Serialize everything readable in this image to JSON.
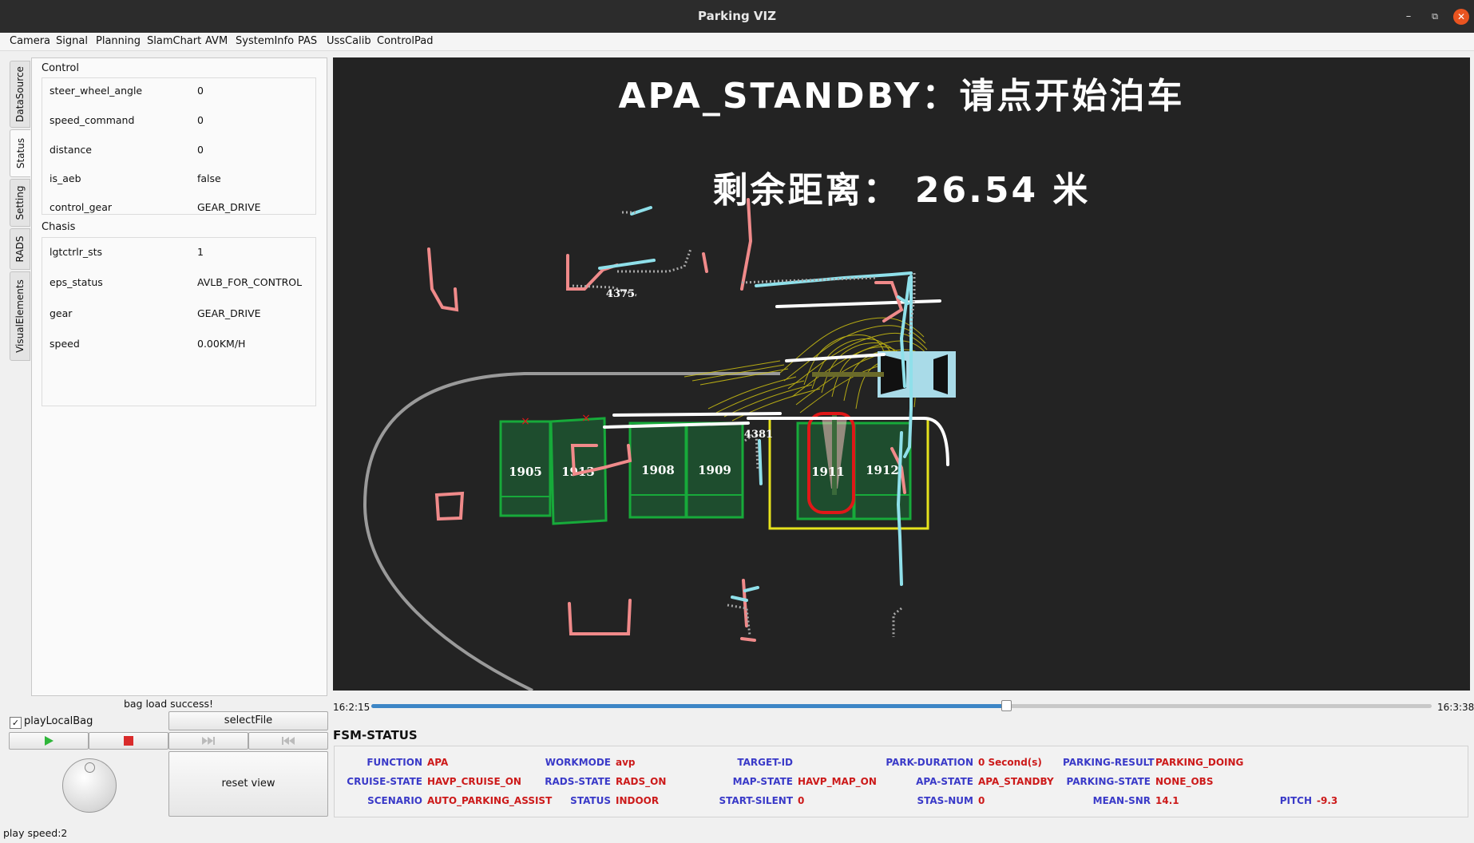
{
  "window": {
    "title": "Parking VIZ"
  },
  "menu": [
    "Camera",
    "Signal",
    "Planning",
    "SlamChart",
    "AVM",
    "SystemInfo",
    "PAS",
    "UssCalib",
    "ControlPad"
  ],
  "side_tabs": [
    "DataSource",
    "Status",
    "Setting",
    "RADS",
    "VisualElements"
  ],
  "status_panel": {
    "control_label": "Control",
    "control": [
      {
        "key": "steer_wheel_angle",
        "value": "0"
      },
      {
        "key": "speed_command",
        "value": "0"
      },
      {
        "key": "distance",
        "value": "0"
      },
      {
        "key": "is_aeb",
        "value": "false"
      },
      {
        "key": "control_gear",
        "value": "GEAR_DRIVE"
      }
    ],
    "chasis_label": "Chasis",
    "chasis": [
      {
        "key": "lgtctrlr_sts",
        "value": "1"
      },
      {
        "key": "eps_status",
        "value": "AVLB_FOR_CONTROL"
      },
      {
        "key": "gear",
        "value": "GEAR_DRIVE"
      },
      {
        "key": "speed",
        "value": "0.00KM/H"
      }
    ]
  },
  "controls": {
    "bag_message": "bag load success!",
    "play_local_bag_label": "playLocalBag",
    "play_local_bag_checked": true,
    "select_file_label": "selectFile",
    "reset_view_label": "reset view",
    "play_speed": "play speed:2"
  },
  "viz": {
    "status_text": "APA_STANDBY：请点开始泊车",
    "distance_text": "剩余距离：  26.54 米",
    "slot_ids": [
      "1905",
      "1913",
      "1908",
      "1909",
      "1911",
      "1912"
    ],
    "obstacle_labels": [
      "4375",
      "4381"
    ]
  },
  "timeline": {
    "start": "16:2:15",
    "end": "16:3:38",
    "progress": 0.599
  },
  "fsm": {
    "title": "FSM-STATUS",
    "items": [
      {
        "label": "FUNCTION",
        "value": "APA"
      },
      {
        "label": "WORKMODE",
        "value": "avp"
      },
      {
        "label": "TARGET-ID",
        "value": ""
      },
      {
        "label": "PARK-DURATION",
        "value": "0 Second(s)"
      },
      {
        "label": "PARKING-RESULT",
        "value": "PARKING_DOING"
      },
      {
        "label": "CRUISE-STATE",
        "value": "HAVP_CRUISE_ON"
      },
      {
        "label": "RADS-STATE",
        "value": "RADS_ON"
      },
      {
        "label": "MAP-STATE",
        "value": "HAVP_MAP_ON"
      },
      {
        "label": "APA-STATE",
        "value": "APA_STANDBY"
      },
      {
        "label": "PARKING-STATE",
        "value": "NONE_OBS"
      },
      {
        "label": "SCENARIO",
        "value": "AUTO_PARKING_ASSIST"
      },
      {
        "label": "STATUS",
        "value": "INDOOR"
      },
      {
        "label": "START-SILENT",
        "value": "0"
      },
      {
        "label": "STAS-NUM",
        "value": "0"
      },
      {
        "label": "MEAN-SNR",
        "value": "14.1"
      },
      {
        "label": "PITCH",
        "value": "-9.3"
      }
    ]
  },
  "colors": {
    "slot_green": "#17aa3a",
    "slot_fill": "#1e4d2e",
    "obstacle_pink": "#f08a8a",
    "lidar_cyan": "#8fe0ea",
    "target_yellow": "#e6e21c",
    "fsm_label": "#3a3ac8",
    "fsm_value": "#cc1a1a"
  }
}
